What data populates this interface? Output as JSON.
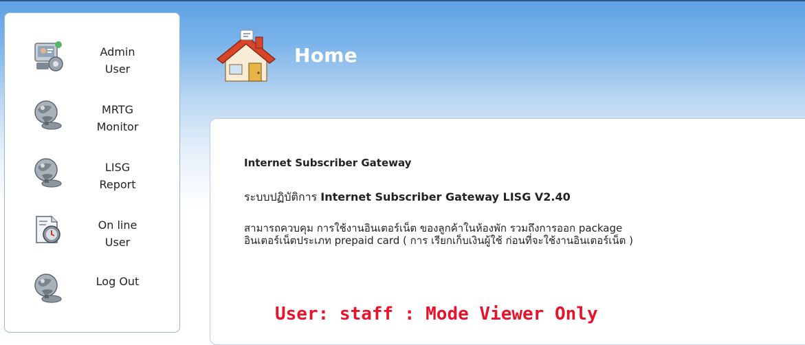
{
  "sidebar": {
    "items": [
      {
        "label": "Admin\nUser",
        "icon": "admin-user-icon"
      },
      {
        "label": "MRTG\nMonitor",
        "icon": "mrtg-monitor-icon"
      },
      {
        "label": "LISG\nReport",
        "icon": "lisg-report-icon"
      },
      {
        "label": "On line\nUser",
        "icon": "online-user-icon"
      },
      {
        "label": "Log Out",
        "icon": "log-out-icon"
      }
    ]
  },
  "header": {
    "title": "Home",
    "icon": "home-icon"
  },
  "content": {
    "heading": "Internet Subscriber Gateway",
    "system_prefix": "ระบบปฏิบัติการ ",
    "system_name": "Internet Subscriber Gateway LISG V2.40",
    "description": "สามารถควบคุม การใช้งานอินเตอร์เน็ต ของลูกค้าในห้องพัก รวมถึงการออก package\nอินเตอร์เน็ตประเภท prepaid card ( การ เรียกเก็บเงินผู้ใช้ ก่อนที่จะใช้งานอินเตอร์เน็ต )",
    "mode_notice": "User: staff : Mode Viewer Only"
  },
  "colors": {
    "header_gradient_top": "#5fa2e6",
    "mode_text": "#e8132b",
    "sidebar_border": "#9ab4cc"
  }
}
